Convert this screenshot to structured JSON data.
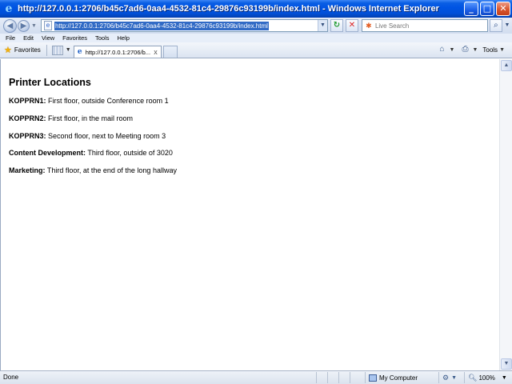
{
  "window": {
    "title": "http://127.0.0.1:2706/b45c7ad6-0aa4-4532-81c4-29876c93199b/index.html - Windows Internet Explorer",
    "buttons": {
      "minimize": "_",
      "maximize": "□",
      "close": "✕"
    }
  },
  "address_bar": {
    "url": "http://127.0.0.1:2706/b45c7ad6-0aa4-4532-81c4-29876c93199b/index.html",
    "back_glyph": "◀",
    "forward_glyph": "▶",
    "refresh_glyph": "↻",
    "stop_glyph": "✕"
  },
  "search": {
    "placeholder": "Live Search",
    "go_glyph": "⌕"
  },
  "menu": {
    "items": [
      "File",
      "Edit",
      "View",
      "Favorites",
      "Tools",
      "Help"
    ]
  },
  "command_bar": {
    "favorites_label": "Favorites",
    "tab_label": "http://127.0.0.1:2706/b...",
    "tab_close": "x",
    "tools_label": "Tools"
  },
  "page": {
    "heading": "Printer Locations",
    "locations": [
      {
        "name": "KOPPRN1:",
        "description": " First floor, outside Conference room 1"
      },
      {
        "name": "KOPPRN2:",
        "description": " First floor, in the mail room"
      },
      {
        "name": "KOPPRN3:",
        "description": " Second floor, next to Meeting room 3"
      },
      {
        "name": "Content Development:",
        "description": " Third floor, outside of 3020"
      },
      {
        "name": "Marketing:",
        "description": " Third floor, at the end of the long hallway"
      }
    ]
  },
  "status_bar": {
    "status": "Done",
    "zone": "My Computer",
    "zoom": "100%"
  },
  "icons": {
    "ie": "ie-logo-icon",
    "favorites": "star-icon",
    "home": "home-icon",
    "print": "printer-icon"
  }
}
